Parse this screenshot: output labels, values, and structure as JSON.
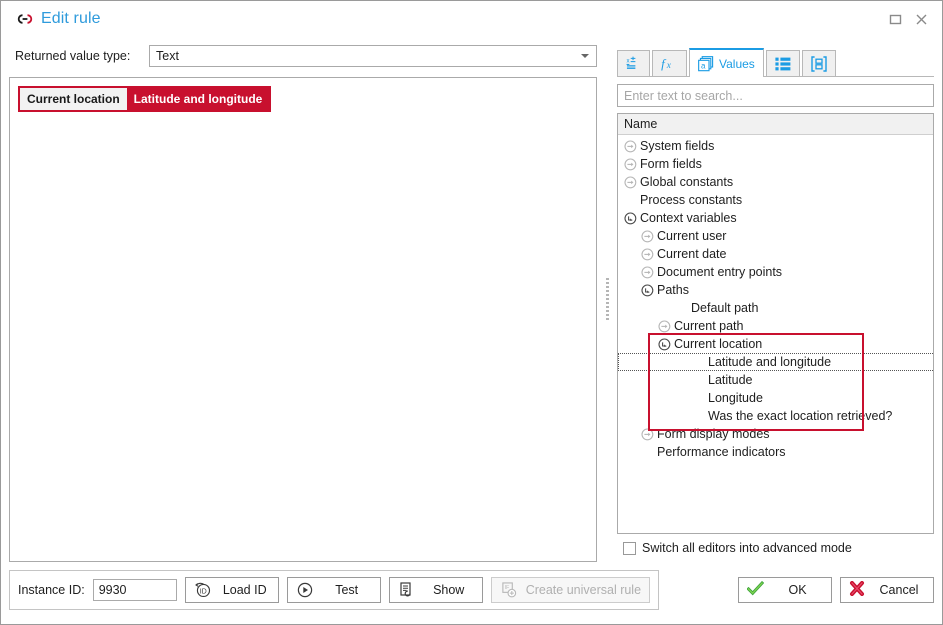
{
  "window": {
    "title": "Edit rule",
    "icon": "chain-link-icon",
    "accent": "#2f9bdc",
    "controls": [
      {
        "name": "maximize-button",
        "glyph": "maximize-icon"
      },
      {
        "name": "close-button",
        "glyph": "close-icon"
      }
    ]
  },
  "editor": {
    "returned_value_type_label": "Returned value type:",
    "returned_value_type_value": "Text",
    "token": {
      "prefix": "Current location",
      "suffix": "Latitude and longitude",
      "border_color": "#c8102e",
      "suffix_bg": "#c8102e"
    }
  },
  "values_panel": {
    "tabs": [
      {
        "label": "",
        "icon": "variables-icon",
        "active": false
      },
      {
        "label": "",
        "icon": "function-fx-icon",
        "active": false
      },
      {
        "label": "Values",
        "icon": "values-cards-icon",
        "active": true
      },
      {
        "label": "",
        "icon": "list-icon",
        "active": false
      },
      {
        "label": "",
        "icon": "form-brackets-icon",
        "active": false
      }
    ],
    "search": {
      "placeholder": "Enter text to search...",
      "value": ""
    },
    "tree_header": "Name",
    "tree": [
      {
        "label": "System fields",
        "depth": 0,
        "state": "collapsed"
      },
      {
        "label": "Form fields",
        "depth": 0,
        "state": "collapsed"
      },
      {
        "label": "Global constants",
        "depth": 0,
        "state": "collapsed"
      },
      {
        "label": "Process constants",
        "depth": 0,
        "state": "leaf"
      },
      {
        "label": "Context variables",
        "depth": 0,
        "state": "expanded"
      },
      {
        "label": "Current user",
        "depth": 1,
        "state": "collapsed"
      },
      {
        "label": "Current date",
        "depth": 1,
        "state": "collapsed"
      },
      {
        "label": "Document entry points",
        "depth": 1,
        "state": "collapsed"
      },
      {
        "label": "Paths",
        "depth": 1,
        "state": "expanded"
      },
      {
        "label": "Default path",
        "depth": 3,
        "state": "leaf"
      },
      {
        "label": "Current path",
        "depth": 2,
        "state": "collapsed"
      },
      {
        "label": "Current location",
        "depth": 2,
        "state": "expanded"
      },
      {
        "label": "Latitude and longitude",
        "depth": 4,
        "state": "leaf",
        "selected": true
      },
      {
        "label": "Latitude",
        "depth": 4,
        "state": "leaf"
      },
      {
        "label": "Longitude",
        "depth": 4,
        "state": "leaf"
      },
      {
        "label": "Was the exact location retrieved?",
        "depth": 4,
        "state": "leaf"
      },
      {
        "label": "Form display modes",
        "depth": 1,
        "state": "collapsed"
      },
      {
        "label": "Performance indicators",
        "depth": 1,
        "state": "leaf"
      }
    ],
    "annotation_color": "#c8102e",
    "advanced_mode": {
      "label": "Switch all editors into advanced mode",
      "checked": false
    }
  },
  "bottom_bar": {
    "instance_id_label": "Instance ID:",
    "instance_id_value": "9930",
    "buttons": [
      {
        "label": "Load ID",
        "icon": "load-id-icon",
        "disabled": false
      },
      {
        "label": "Test",
        "icon": "play-circle-icon",
        "disabled": false
      },
      {
        "label": "Show",
        "icon": "document-arrow-icon",
        "disabled": false
      },
      {
        "label": "Create universal rule",
        "icon": "create-rule-icon",
        "disabled": true
      }
    ],
    "ok_label": "OK",
    "cancel_label": "Cancel",
    "ok_icon": "green-check-icon",
    "cancel_icon": "red-x-icon"
  }
}
